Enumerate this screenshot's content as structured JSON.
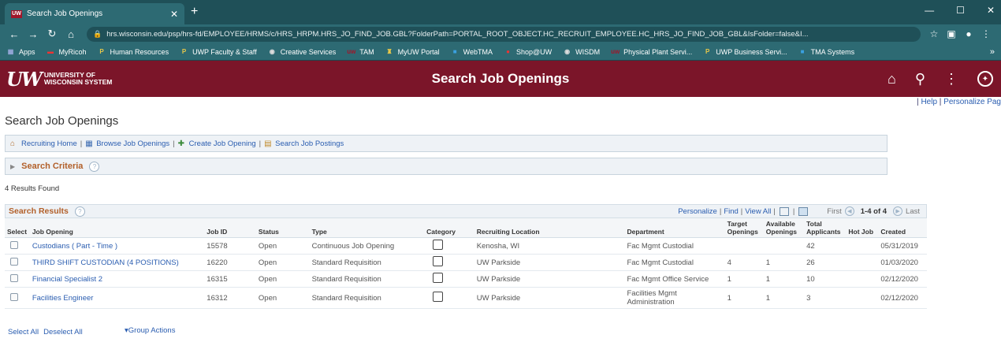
{
  "browser": {
    "tab_title": "Search Job Openings",
    "tab_favicon": "UW",
    "url_host": "hrs.wisconsin.edu",
    "url_path": "/psp/hrs-fd/EMPLOYEE/HRMS/c/HRS_HRPM.HRS_JO_FIND_JOB.GBL?FolderPath=PORTAL_ROOT_OBJECT.HC_RECRUIT_EMPLOYEE.HC_HRS_JO_FIND_JOB_GBL&IsFolder=false&I...",
    "bookmarks": [
      {
        "label": "Apps",
        "icon": "apps-grid-icon"
      },
      {
        "label": "MyRicoh",
        "icon": "ricoh-icon"
      },
      {
        "label": "Human Resources",
        "icon": "p-icon"
      },
      {
        "label": "UWP Faculty & Staff",
        "icon": "p-icon"
      },
      {
        "label": "Creative Services",
        "icon": "globe-icon"
      },
      {
        "label": "TAM",
        "icon": "uw-icon"
      },
      {
        "label": "MyUW Portal",
        "icon": "uw-crest-icon"
      },
      {
        "label": "WebTMA",
        "icon": "tma-icon"
      },
      {
        "label": "Shop@UW",
        "icon": "shop-icon"
      },
      {
        "label": "WISDM",
        "icon": "globe-icon"
      },
      {
        "label": "Physical Plant Servi...",
        "icon": "uw-icon"
      },
      {
        "label": "UWP Business Servi...",
        "icon": "p-icon"
      },
      {
        "label": "TMA Systems",
        "icon": "tma-icon"
      }
    ]
  },
  "header": {
    "logo_line1": "UNIVERSITY OF",
    "logo_line2": "WISCONSIN SYSTEM",
    "logo_mark": "UW",
    "title": "Search Job Openings"
  },
  "toplinks": {
    "help": "Help",
    "personalize": "Personalize Pag"
  },
  "page_title": "Search Job Openings",
  "linkbar": [
    {
      "label": "Recruiting Home",
      "icon": "home-icon"
    },
    {
      "label": "Browse Job Openings",
      "icon": "browse-icon"
    },
    {
      "label": "Create Job Opening",
      "icon": "create-icon"
    },
    {
      "label": "Search Job Postings",
      "icon": "search-postings-icon"
    }
  ],
  "criteria_label": "Search Criteria",
  "results_found": "4 Results Found",
  "grid": {
    "title": "Search Results",
    "personalize": "Personalize",
    "find": "Find",
    "view_all": "View All",
    "first": "First",
    "range": "1-4 of 4",
    "last": "Last",
    "columns": [
      "Select",
      "Job Opening",
      "Job ID",
      "Status",
      "Type",
      "Category",
      "Recruiting Location",
      "Department",
      "Target Openings",
      "Available Openings",
      "Total Applicants",
      "Hot Job",
      "Created"
    ],
    "rows": [
      {
        "job_opening": "Custodians ( Part - Time )",
        "job_id": "15578",
        "status": "Open",
        "type": "Continuous Job Opening",
        "location": "Kenosha, WI",
        "department": "Fac Mgmt Custodial",
        "target": "",
        "available": "",
        "applicants": "42",
        "hot": "",
        "created": "05/31/2019"
      },
      {
        "job_opening": "THIRD SHIFT CUSTODIAN (4 POSITIONS)",
        "job_id": "16220",
        "status": "Open",
        "type": "Standard Requisition",
        "location": "UW Parkside",
        "department": "Fac Mgmt Custodial",
        "target": "4",
        "available": "1",
        "applicants": "26",
        "hot": "",
        "created": "01/03/2020"
      },
      {
        "job_opening": "Financial Specialist 2",
        "job_id": "16315",
        "status": "Open",
        "type": "Standard Requisition",
        "location": "UW Parkside",
        "department": "Fac Mgmt Office Service",
        "target": "1",
        "available": "1",
        "applicants": "10",
        "hot": "",
        "created": "02/12/2020"
      },
      {
        "job_opening": "Facilities Engineer",
        "job_id": "16312",
        "status": "Open",
        "type": "Standard Requisition",
        "location": "UW Parkside",
        "department": "Facilities Mgmt Administration",
        "target": "1",
        "available": "1",
        "applicants": "3",
        "hot": "",
        "created": "02/12/2020"
      }
    ]
  },
  "footer": {
    "select_all": "Select All",
    "deselect_all": "Deselect All",
    "group_actions": "Group Actions"
  }
}
